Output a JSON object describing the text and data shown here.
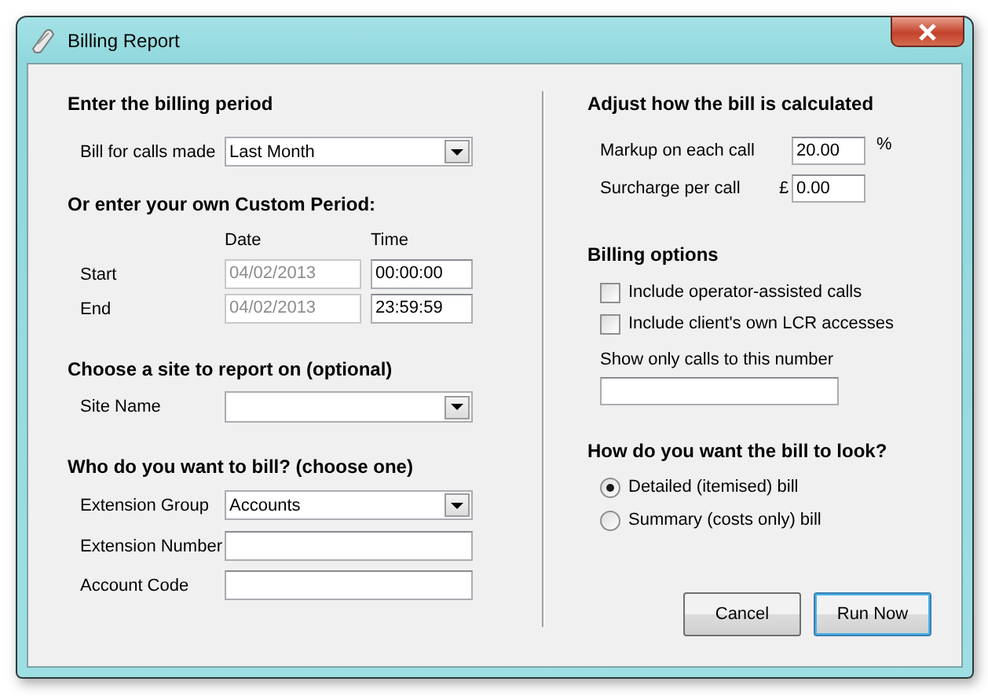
{
  "window": {
    "title": "Billing Report"
  },
  "billing_period": {
    "heading": "Enter the billing period",
    "label": "Bill for calls made",
    "value": "Last Month"
  },
  "custom_period": {
    "heading": "Or enter your own Custom Period:",
    "date_header": "Date",
    "time_header": "Time",
    "rows": [
      {
        "label": "Start",
        "date": "04/02/2013",
        "time": "00:00:00",
        "date_disabled": true
      },
      {
        "label": "End",
        "date": "04/02/2013",
        "time": "23:59:59",
        "date_disabled": true
      }
    ]
  },
  "site": {
    "heading": "Choose a site to report on (optional)",
    "label": "Site Name"
  },
  "bill_to": {
    "heading": "Who do you want to bill? (choose one)",
    "fields": [
      {
        "kind": "dropdown",
        "label": "Extension Group",
        "value": "Accounts"
      },
      {
        "kind": "text",
        "label": "Extension Number"
      },
      {
        "kind": "text",
        "label": "Account Code"
      }
    ]
  },
  "calculation": {
    "heading": "Adjust how the bill is calculated",
    "fields": [
      {
        "label": "Markup on each call",
        "value": "20.00",
        "suffix": "%"
      },
      {
        "label": "Surcharge per call",
        "prefix": "£",
        "value": "0.00"
      }
    ]
  },
  "billing_options": {
    "heading": "Billing options",
    "options": [
      {
        "label": "Include operator-assisted calls",
        "checked": false
      },
      {
        "label": "Include client's own LCR accesses",
        "checked": false
      }
    ],
    "number_label": "Show only calls to this number"
  },
  "bill_style": {
    "heading": "How do you want the bill to look?",
    "options": [
      {
        "label": "Detailed (itemised) bill",
        "selected": true
      },
      {
        "label": "Summary (costs only) bill",
        "selected": false
      }
    ]
  },
  "buttons": [
    {
      "label": "Cancel",
      "default": false
    },
    {
      "label": "Run Now",
      "default": true
    }
  ]
}
